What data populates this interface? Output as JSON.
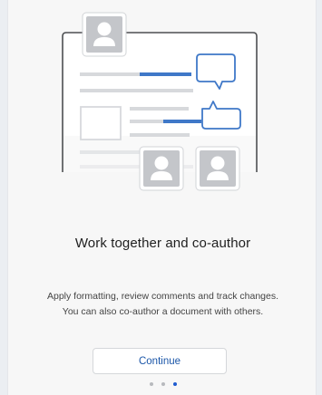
{
  "slide": {
    "title": "Work together and co-author",
    "description_lines": [
      "Apply formatting, review comments and track changes.",
      "You can also co-author a document with others."
    ],
    "continue_label": "Continue"
  },
  "pager": {
    "total": 3,
    "active_index": 2
  },
  "colors": {
    "accent": "#1e5bd0",
    "button_text": "#1b56a8",
    "illustration_blue": "#3f78c8",
    "illustration_gray": "#d7d9dc",
    "dot_inactive": "#b7b9bd"
  },
  "icons": [
    "person-avatar-icon",
    "comment-bubble-icon",
    "document-icon"
  ]
}
